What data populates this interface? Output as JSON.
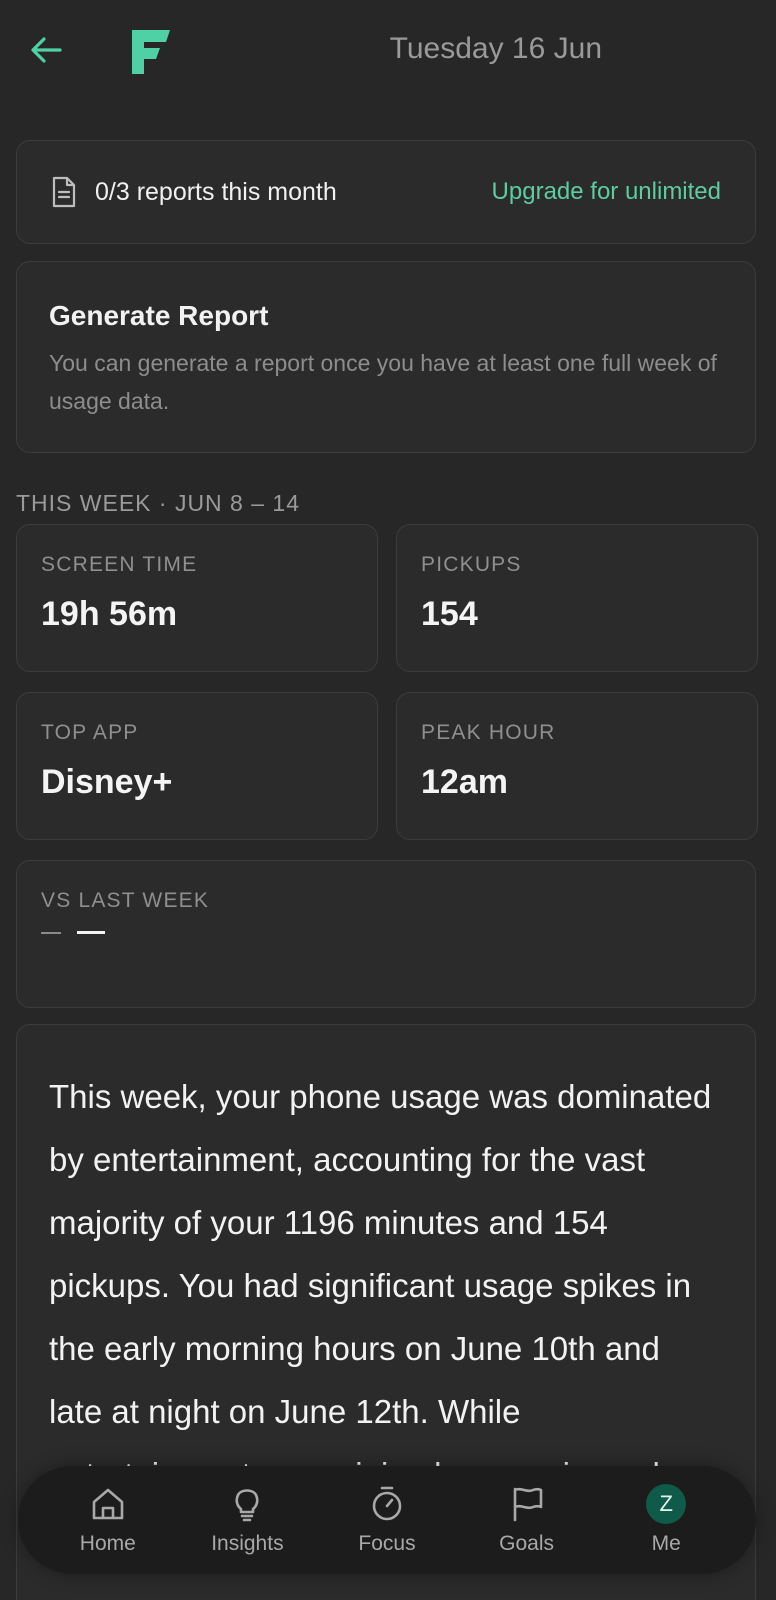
{
  "header": {
    "date": "Tuesday 16 Jun",
    "back_icon": "arrow-left-icon",
    "logo_icon": "app-logo-icon",
    "accent_color": "#4fd1a5"
  },
  "reports": {
    "icon": "document-icon",
    "count_text": "0/3 reports this month",
    "upgrade_label": "Upgrade for unlimited"
  },
  "generate": {
    "title": "Generate Report",
    "description": "You can generate a report once you have at least one full week of usage data."
  },
  "week": {
    "label": "THIS WEEK · JUN 8 – 14",
    "screen_time": {
      "label": "SCREEN TIME",
      "value": "19h 56m"
    },
    "pickups": {
      "label": "PICKUPS",
      "value": "154"
    },
    "top_app": {
      "label": "TOP APP",
      "value": "Disney+"
    },
    "peak_hour": {
      "label": "PEAK HOUR",
      "value": "12am"
    },
    "vs_last_week": {
      "label": "VS LAST WEEK"
    }
  },
  "summary": {
    "text": "This week, your phone usage was dominated by entertainment, accounting for the vast majority of your 1196 minutes and 154 pickups. You had significant usage spikes in the early morning hours on June 10th and late at night on June 12th. While entertainment was minimal, appearing only on June"
  },
  "nav": {
    "home": {
      "label": "Home",
      "icon": "home-icon"
    },
    "insights": {
      "label": "Insights",
      "icon": "lightbulb-icon"
    },
    "focus": {
      "label": "Focus",
      "icon": "timer-icon"
    },
    "goals": {
      "label": "Goals",
      "icon": "flag-icon"
    },
    "me": {
      "label": "Me",
      "avatar_letter": "Z"
    }
  }
}
